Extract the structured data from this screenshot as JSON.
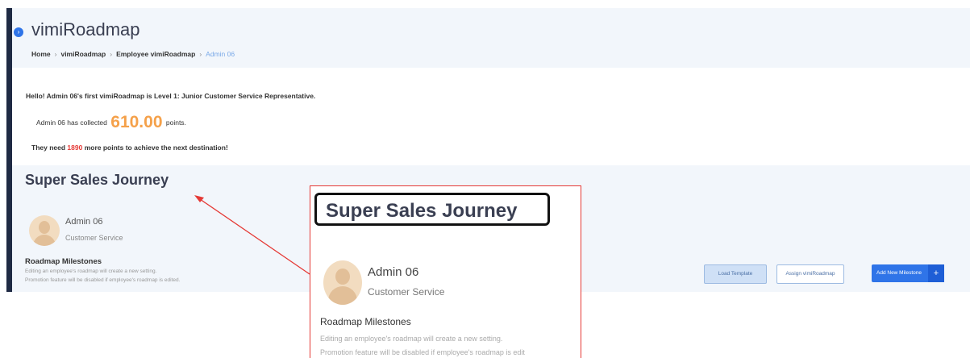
{
  "header": {
    "app_title": "vimiRoadmap",
    "breadcrumb": [
      "Home",
      "vimiRoadmap",
      "Employee vimiRoadmap",
      "Admin 06"
    ]
  },
  "info": {
    "hello": "Hello! Admin 06's first vimiRoadmap is Level 1: Junior Customer Service Representative.",
    "collected_prefix": "Admin 06 has collected",
    "points": "610.00",
    "collected_suffix": "points.",
    "need_prefix": "They need",
    "need_points": "1890",
    "need_suffix": "more points to achieve the next destination!"
  },
  "journey": {
    "title": "Super Sales Journey",
    "user_name": "Admin 06",
    "user_role": "Customer Service",
    "milestones_title": "Roadmap Milestones",
    "milestones_desc1": "Editing an employee's roadmap will create a new setting.",
    "milestones_desc2": "Promotion feature will be disabled if employee's roadmap is edited."
  },
  "buttons": {
    "load_template": "Load Template",
    "assign": "Assign vimiRoadmap",
    "add_milestone": "Add New Milestone",
    "add_plus": "+"
  },
  "zoom": {
    "title": "Super Sales Journey",
    "user_name": "Admin 06",
    "user_role": "Customer Service",
    "milestones_title": "Roadmap Milestones",
    "desc1": "Editing an employee's roadmap will create a new setting.",
    "desc2": "Promotion feature will be disabled if employee's roadmap is edit"
  },
  "icons": {
    "collapse": "chevron-right-icon",
    "avatar": "user-avatar-icon",
    "plus": "plus-icon"
  },
  "colors": {
    "accent": "#2f74e8",
    "points": "#f5a14a",
    "need": "#e53935",
    "sidebar": "#1f2a44",
    "annotation": "#e53935"
  }
}
